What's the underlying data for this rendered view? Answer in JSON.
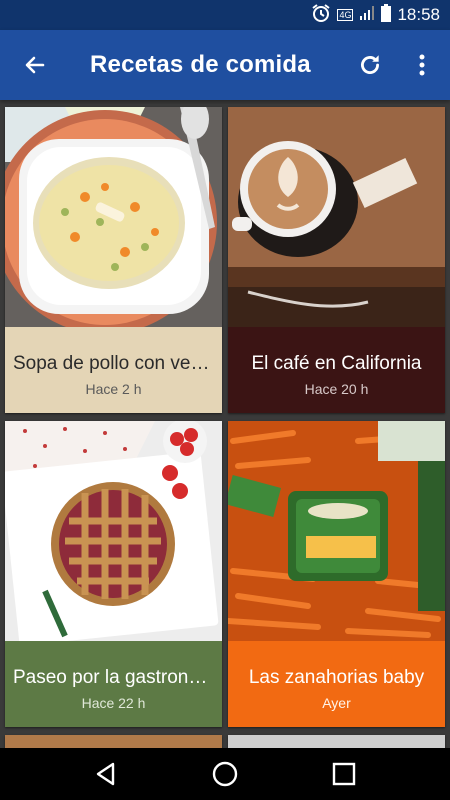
{
  "status": {
    "time": "18:58",
    "network": "4G"
  },
  "appbar": {
    "title": "Recetas de comida"
  },
  "cards": [
    {
      "title": "Sopa de pollo con verduras",
      "time": "Hace 2 h",
      "caption_bg": "#e4d5b6",
      "caption_fg": "#2b2b2b",
      "time_fg": "#5a5a5a"
    },
    {
      "title": "El café en California",
      "time": "Hace 20 h",
      "caption_bg": "#3b1414",
      "caption_fg": "#ffffff",
      "time_fg": "#d8caca"
    },
    {
      "title": "Paseo por la gastronomía",
      "time": "Hace 22 h",
      "caption_bg": "#5d7a45",
      "caption_fg": "#ffffff",
      "time_fg": "#e0e8d8"
    },
    {
      "title": "Las zanahorias baby",
      "time": "Ayer",
      "caption_bg": "#f26a12",
      "caption_fg": "#ffffff",
      "time_fg": "#fff3e8"
    }
  ],
  "icons": {
    "back": "arrow-back-icon",
    "refresh": "refresh-icon",
    "overflow": "more-vert-icon",
    "nav_back": "triangle-back-icon",
    "nav_home": "circle-home-icon",
    "nav_recents": "square-recents-icon"
  }
}
